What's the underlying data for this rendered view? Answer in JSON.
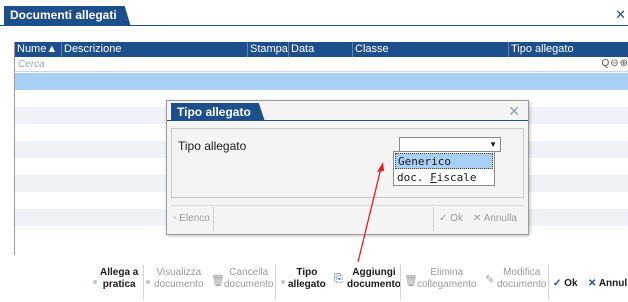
{
  "window": {
    "title": "Documenti allegati",
    "close_icon": "close-icon"
  },
  "grid": {
    "columns": [
      {
        "label": "Nume▲"
      },
      {
        "label": "Descrizione"
      },
      {
        "label": "Stampa"
      },
      {
        "label": "Data"
      },
      {
        "label": "Classe"
      },
      {
        "label": "Tipo allegato"
      }
    ],
    "search_placeholder": "Cerca",
    "search_icons": "Q⊖⊕"
  },
  "dialog": {
    "title": "Tipo allegato",
    "field_label": "Tipo allegato",
    "select_value": "",
    "options": [
      {
        "label": "Generico",
        "selected": true
      },
      {
        "pre": "doc. ",
        "accel": "F",
        "post": "iscale",
        "selected": false
      }
    ],
    "buttons": {
      "elenco": "Elenco",
      "ok": "Ok",
      "annulla": "Annulla"
    }
  },
  "toolbar": {
    "allega": [
      "Allega a",
      "pratica"
    ],
    "visualizza": [
      "Visualizza",
      "documento"
    ],
    "cancella": [
      "Cancella",
      "documento"
    ],
    "tipo": [
      "Tipo",
      "allegato"
    ],
    "aggiungi": [
      "Aggiungi",
      "documento"
    ],
    "elimina": [
      "Elimina",
      "collegamento"
    ],
    "modifica": [
      "Modifica",
      "documento"
    ],
    "ok": "Ok",
    "annulla": "Annul"
  },
  "colors": {
    "accent": "#1d4f8c",
    "selection": "#a8d0f5",
    "annotation_arrow": "#e02020"
  }
}
